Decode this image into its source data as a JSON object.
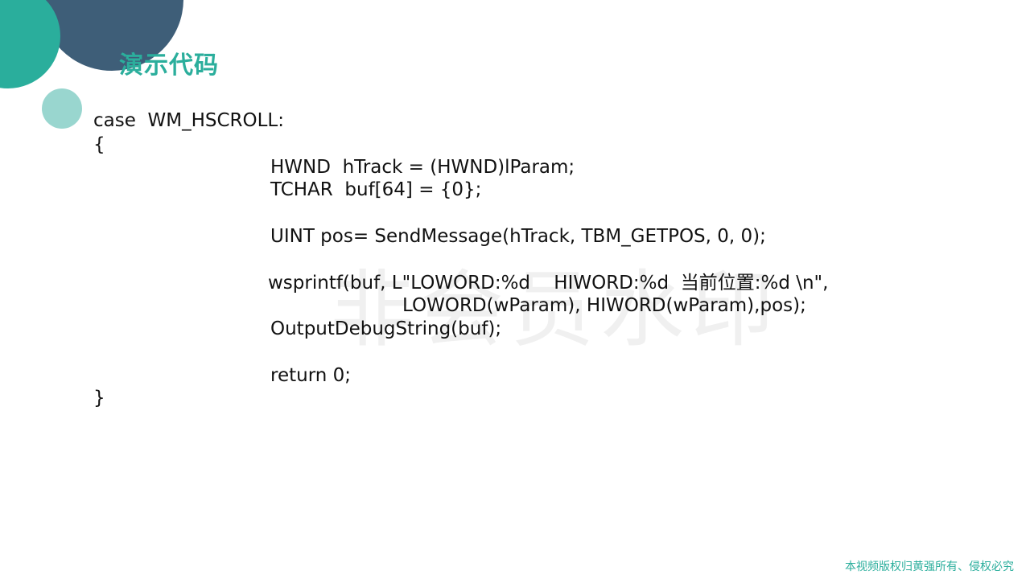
{
  "slide": {
    "title": "演示代码",
    "watermark": "非会员水印",
    "footer": "本视频版权归黄强所有、侵权必究"
  },
  "code": {
    "line1": "case  WM_HSCROLL:",
    "line2": "{",
    "line3": "HWND  hTrack = (HWND)lParam;",
    "line4": "TCHAR  buf[64] = {0};",
    "line5": "UINT pos= SendMessage(hTrack, TBM_GETPOS, 0, 0);",
    "line6": "wsprintf(buf, L\"LOWORD:%d    HIWORD:%d  当前位置:%d \\n\",",
    "line7": "LOWORD(wParam), HIWORD(wParam),pos);",
    "line8": "OutputDebugString(buf);",
    "line9": "return 0;",
    "line10": "}"
  },
  "colors": {
    "accent": "#2bae9c",
    "dark_circle": "#3e5e78",
    "light_circle": "#99d6cf"
  }
}
